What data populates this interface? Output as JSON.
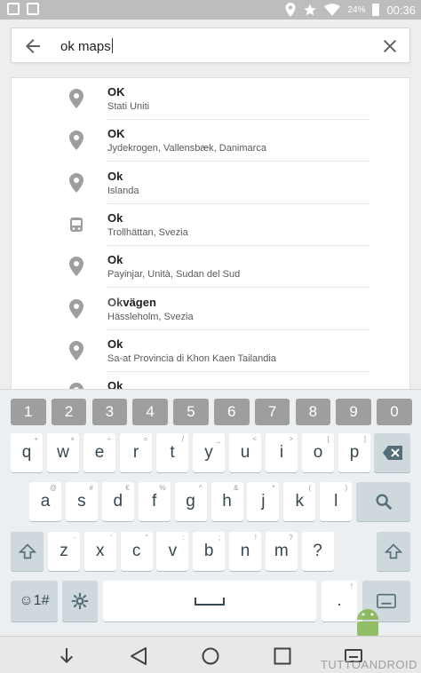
{
  "status_bar": {
    "battery": "24%",
    "time": "00:36"
  },
  "search": {
    "query": "ok maps"
  },
  "results": [
    {
      "match": "OK",
      "rest": "",
      "subtitle": "Stati Uniti",
      "icon": "place-pin-icon"
    },
    {
      "match": "OK",
      "rest": "",
      "subtitle": "Jydekrogen, Vallensbæk, Danimarca",
      "icon": "place-pin-icon"
    },
    {
      "match": "Ok",
      "rest": "",
      "subtitle": "Islanda",
      "icon": "place-pin-icon"
    },
    {
      "match": "Ok",
      "rest": "",
      "subtitle": "Trollhättan, Svezia",
      "icon": "transit-station-icon"
    },
    {
      "match": "Ok",
      "rest": "",
      "subtitle": "Payinjar, Unità, Sudan del Sud",
      "icon": "place-pin-icon"
    },
    {
      "match": "Ok",
      "rest": "vägen",
      "subtitle": "Hässleholm, Svezia",
      "icon": "place-pin-icon"
    },
    {
      "match": "Ok",
      "rest": "",
      "subtitle": "Sa-at Provincia di Khon Kaen Tailandia",
      "icon": "place-pin-icon"
    },
    {
      "match": "Ok",
      "rest": "",
      "subtitle": "",
      "icon": "place-pin-icon"
    }
  ],
  "keyboard": {
    "numbers": [
      "1",
      "2",
      "3",
      "4",
      "5",
      "6",
      "7",
      "8",
      "9",
      "0"
    ],
    "row1": [
      "q",
      "w",
      "e",
      "r",
      "t",
      "y",
      "u",
      "i",
      "o",
      "p"
    ],
    "row1_hints": [
      "+",
      "×",
      "÷",
      "=",
      "/",
      "_",
      "<",
      ">",
      "[",
      "]"
    ],
    "row2": [
      "a",
      "s",
      "d",
      "f",
      "g",
      "h",
      "j",
      "k",
      "l"
    ],
    "row2_hints": [
      "@",
      "#",
      "€",
      "%",
      "^",
      "&",
      "*",
      "(",
      ")"
    ],
    "row3": [
      "z",
      "x",
      "c",
      "v",
      "b",
      "n",
      "m",
      "?"
    ],
    "row3_hints": [
      "-",
      "'",
      "\"",
      ":",
      ";",
      "!",
      "?",
      "",
      ""
    ],
    "row3_last_hint": "¿",
    "symbols_label": "☺1#",
    "comma": ",",
    "period": ".",
    "comma_hint": "",
    "period_hint": "!"
  },
  "watermark": "TUTTOANDROID",
  "colors": {
    "accent": "#9e9e9e",
    "keyboard_bg": "#eceff1",
    "status_bar": "#bdbdbd"
  }
}
